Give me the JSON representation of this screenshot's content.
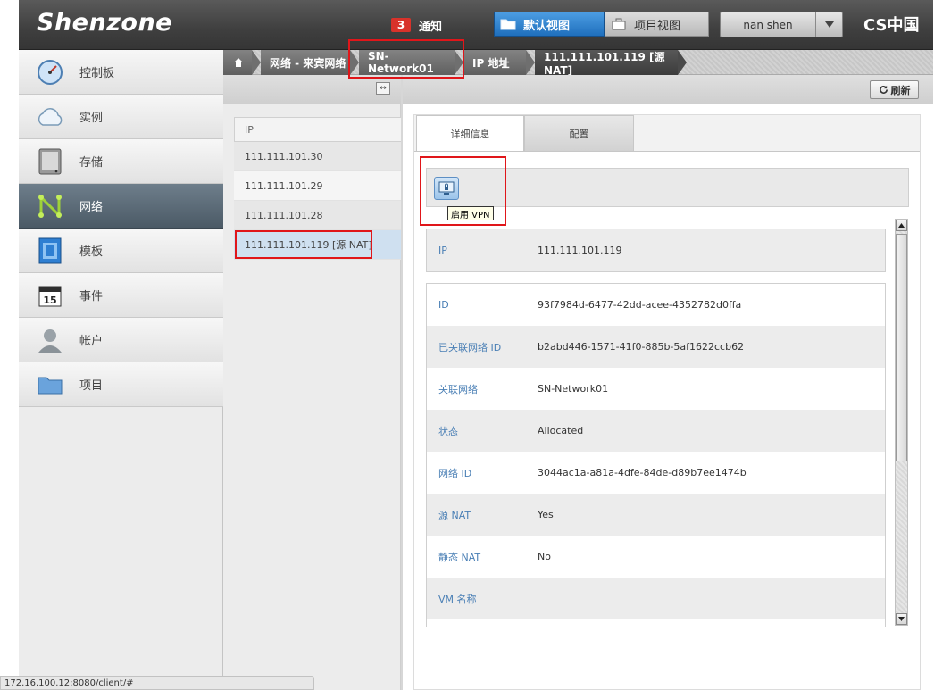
{
  "header": {
    "logo": "Shenzone",
    "notification_count": "3",
    "notification_label": "通知",
    "view_default": "默认视图",
    "view_project": "项目视图",
    "user_name": "nan shen",
    "brand": "CS中国"
  },
  "sidebar": {
    "items": [
      {
        "label": "控制板",
        "icon": "dashboard-icon"
      },
      {
        "label": "实例",
        "icon": "cloud-icon"
      },
      {
        "label": "存储",
        "icon": "storage-icon"
      },
      {
        "label": "网络",
        "icon": "network-icon"
      },
      {
        "label": "模板",
        "icon": "template-icon"
      },
      {
        "label": "事件",
        "icon": "calendar-icon"
      },
      {
        "label": "帐户",
        "icon": "user-icon"
      },
      {
        "label": "项目",
        "icon": "folder-icon"
      }
    ],
    "active_index": 3,
    "calendar_day": "15"
  },
  "breadcrumb": {
    "items": [
      "网络 - 来宾网络",
      "SN-Network01",
      "IP 地址",
      "111.111.101.119 [源 NAT]"
    ]
  },
  "ip_list": {
    "header": "IP",
    "rows": [
      "111.111.101.30",
      "111.111.101.29",
      "111.111.101.28",
      "111.111.101.119 [源 NAT]"
    ],
    "selected_index": 3
  },
  "detail": {
    "refresh_label": "刷新",
    "tabs": [
      "详细信息",
      "配置"
    ],
    "active_tab": 0,
    "vpn_tooltip": "启用 VPN",
    "ip_row": {
      "key": "IP",
      "value": "111.111.101.119"
    },
    "fields": [
      {
        "key": "ID",
        "value": "93f7984d-6477-42dd-acee-4352782d0ffa"
      },
      {
        "key": "已关联网络 ID",
        "value": "b2abd446-1571-41f0-885b-5af1622ccb62"
      },
      {
        "key": "关联网络",
        "value": "SN-Network01"
      },
      {
        "key": "状态",
        "value": "Allocated"
      },
      {
        "key": "网络 ID",
        "value": "3044ac1a-a81a-4dfe-84de-d89b7ee1474b"
      },
      {
        "key": "源 NAT",
        "value": "Yes"
      },
      {
        "key": "静态 NAT",
        "value": "No"
      },
      {
        "key": "VM 名称",
        "value": ""
      }
    ]
  },
  "status_bar": "172.16.100.12:8080/client/#",
  "colors": {
    "accent_blue": "#1f6fbd",
    "highlight_red": "#e0161a",
    "field_key": "#4a7fb5",
    "notification_red": "#d8322a"
  }
}
